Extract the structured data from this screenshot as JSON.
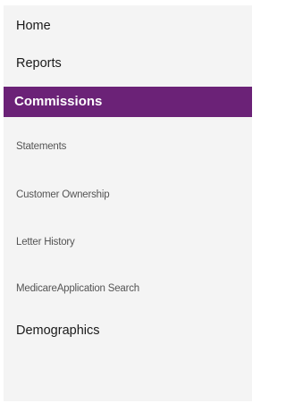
{
  "nav": {
    "home": "Home",
    "reports": "Reports",
    "commissions": "Commissions",
    "commissions_sub": {
      "statements": "Statements",
      "customer_ownership": "Customer Ownership",
      "letter_history": "Letter History",
      "medicare_application_search": "MedicareApplication Search"
    },
    "demographics": "Demographics"
  },
  "colors": {
    "active_background": "#6b2277",
    "active_text": "#ffffff",
    "panel_background": "#f4f4f4"
  }
}
